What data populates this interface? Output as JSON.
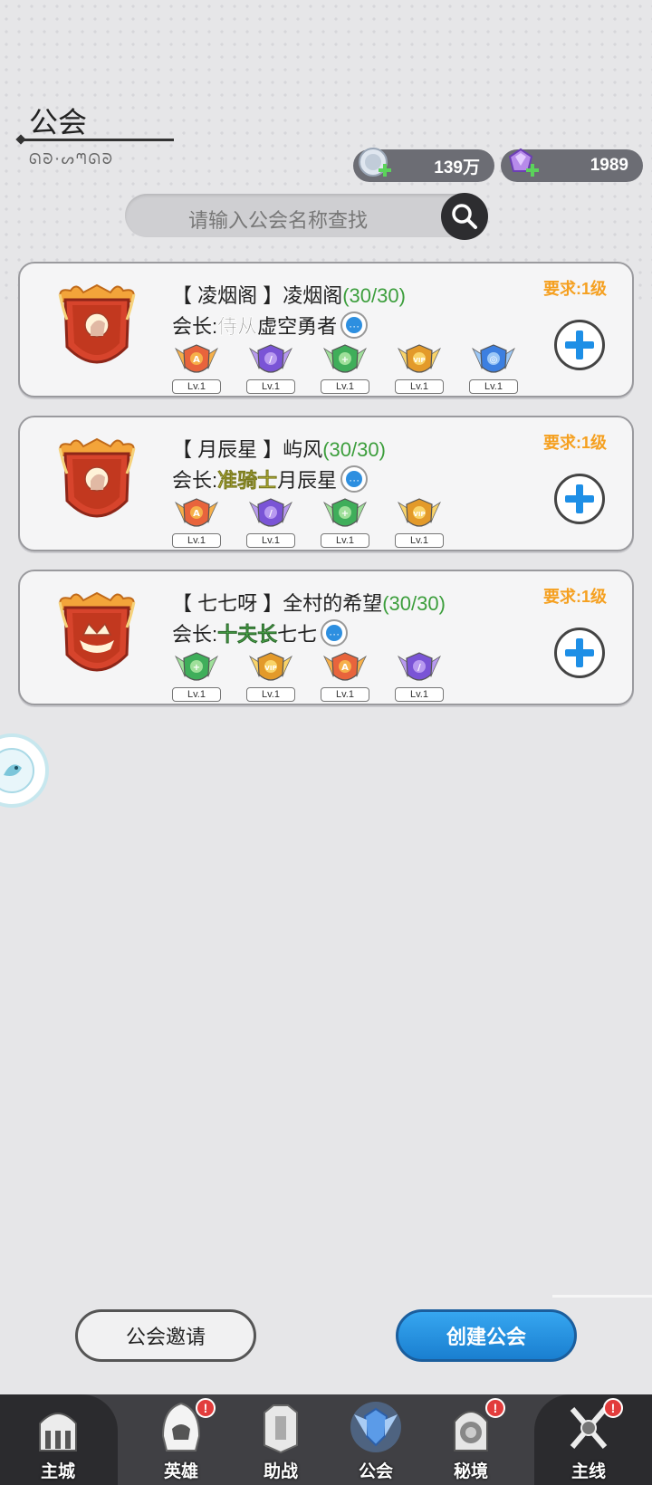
{
  "header": {
    "title": "公会",
    "subtitle": "ᘏᘐ·ᔕᘉᘏᘐ"
  },
  "currencies": [
    {
      "name": "coin",
      "value": "139万",
      "icon": "silver-coin-add-icon"
    },
    {
      "name": "gem",
      "value": "1989",
      "icon": "purple-gem-add-icon"
    }
  ],
  "search": {
    "placeholder": "请输入公会名称查找",
    "icon": "search-icon"
  },
  "guilds": [
    {
      "name": "【 凌烟阁 】凌烟阁",
      "count": "(30/30)",
      "leader_prefix": "会长:",
      "leader_rank": "侍从",
      "leader_rank_color": "gray",
      "leader_name": "虚空勇者",
      "requirement": "要求:1级",
      "emblem": "knight-shield-emblem",
      "members": [
        {
          "level": "Lv.1",
          "badge": "red-a-badge"
        },
        {
          "level": "Lv.1",
          "badge": "purple-sword-badge"
        },
        {
          "level": "Lv.1",
          "badge": "green-cross-badge"
        },
        {
          "level": "Lv.1",
          "badge": "gold-vip-badge"
        },
        {
          "level": "Lv.1",
          "badge": "blue-target-badge"
        }
      ]
    },
    {
      "name": "【 月辰星 】屿风",
      "count": "(30/30)",
      "leader_prefix": "会长:",
      "leader_rank": "准骑士",
      "leader_rank_color": "yellow",
      "leader_name": "月辰星",
      "requirement": "要求:1级",
      "emblem": "knight-shield-emblem",
      "members": [
        {
          "level": "Lv.1",
          "badge": "red-a-badge"
        },
        {
          "level": "Lv.1",
          "badge": "purple-sword-badge"
        },
        {
          "level": "Lv.1",
          "badge": "green-cross-badge"
        },
        {
          "level": "Lv.1",
          "badge": "gold-vip-badge"
        }
      ]
    },
    {
      "name": "【 七七呀 】全村的希望",
      "count": "(30/30)",
      "leader_prefix": "会长:",
      "leader_rank": "十夫长",
      "leader_rank_color": "green",
      "leader_name": "七七",
      "requirement": "要求:1级",
      "emblem": "crown-shield-emblem",
      "members": [
        {
          "level": "Lv.1",
          "badge": "green-cross-badge"
        },
        {
          "level": "Lv.1",
          "badge": "gold-vip-badge"
        },
        {
          "level": "Lv.1",
          "badge": "red-a-badge"
        },
        {
          "level": "Lv.1",
          "badge": "purple-sword-badge"
        }
      ]
    }
  ],
  "buttons": {
    "invite": "公会邀请",
    "create": "创建公会"
  },
  "navbar": [
    {
      "label": "主城",
      "icon": "castle-icon",
      "alert": false
    },
    {
      "label": "英雄",
      "icon": "hero-hood-icon",
      "alert": true
    },
    {
      "label": "助战",
      "icon": "armor-icon",
      "alert": false
    },
    {
      "label": "公会",
      "icon": "guild-wings-icon",
      "alert": false,
      "active": true
    },
    {
      "label": "秘境",
      "icon": "portal-icon",
      "alert": true
    },
    {
      "label": "主线",
      "icon": "crossed-swords-icon",
      "alert": true
    }
  ],
  "colors": {
    "accent": "#2196e8",
    "requirement": "#f5a020",
    "count": "#3c9e3c",
    "alert": "#e23c3c"
  }
}
